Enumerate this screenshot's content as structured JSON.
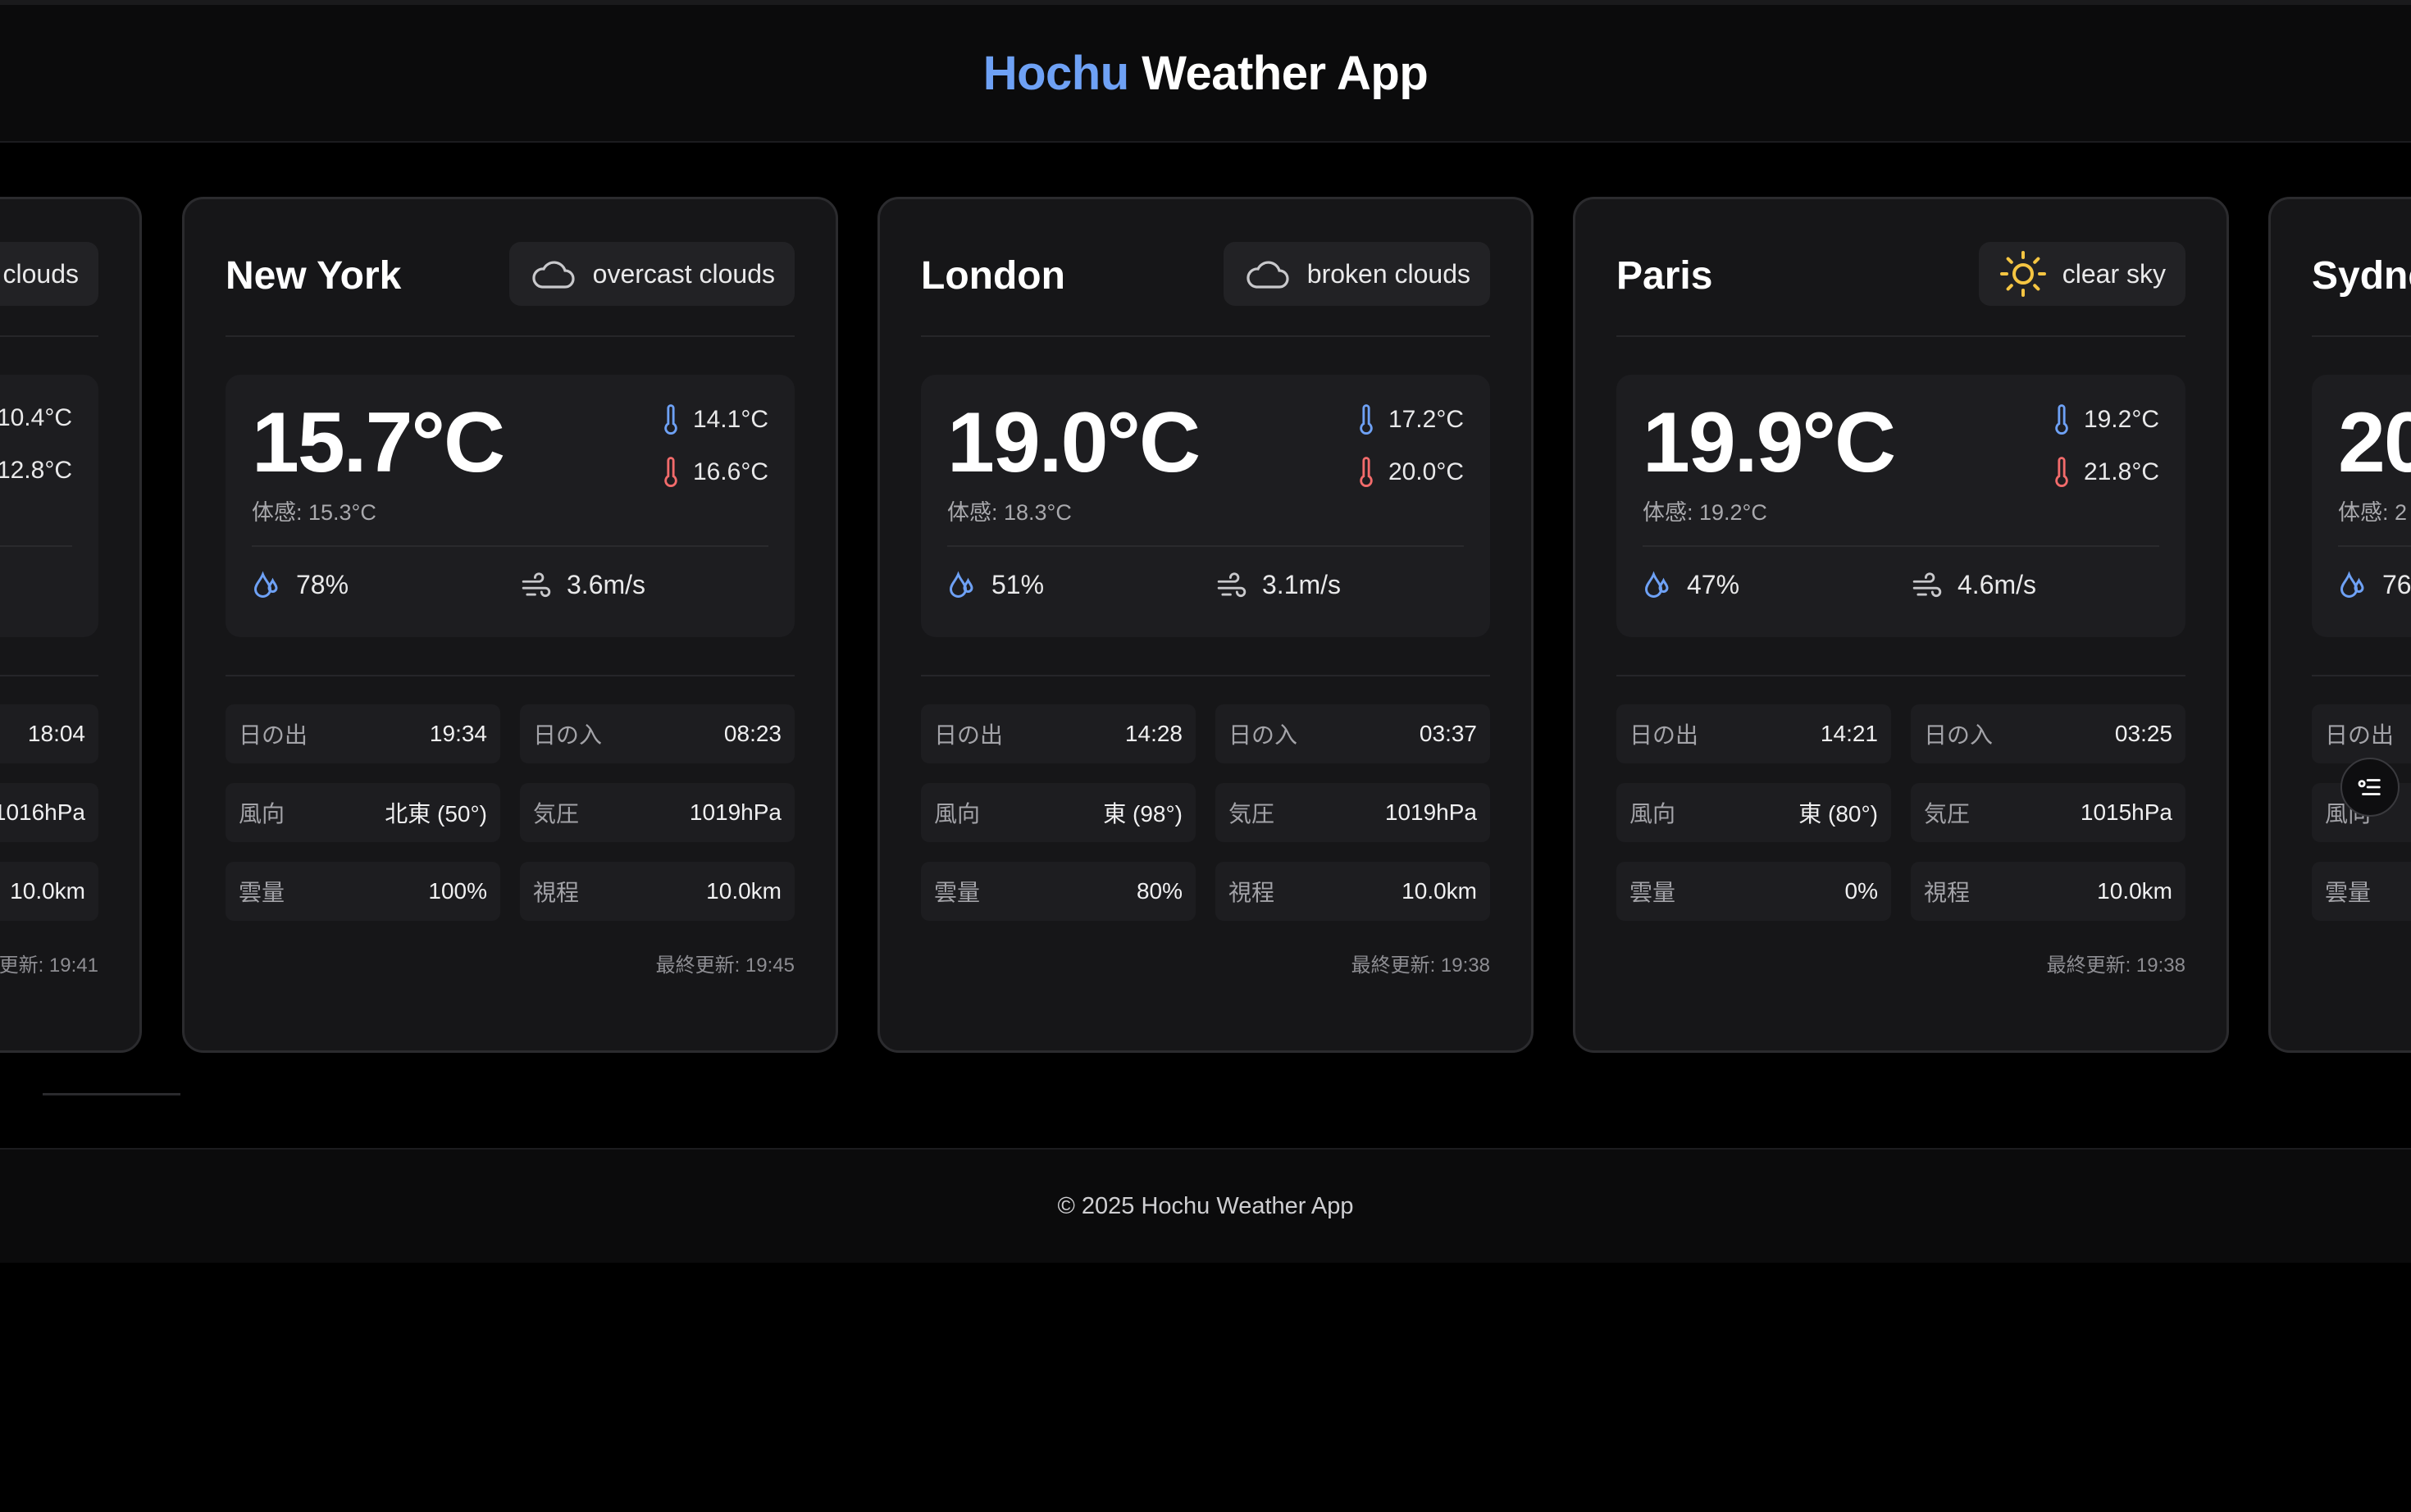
{
  "header": {
    "brand": "Hochu",
    "title_rest": " Weather App"
  },
  "labels": {
    "feels_prefix": "体感: ",
    "sunrise": "日の出",
    "sunset": "日の入",
    "wind_dir": "風向",
    "pressure": "気圧",
    "clouds": "雲量",
    "visibility": "視程",
    "updated_prefix": "最終更新: "
  },
  "cards": [
    {
      "city": "",
      "condition": "clouds",
      "condition_icon": "cloud-icon",
      "temp_min": "10.4°C",
      "temp_max": "12.8°C",
      "sunset": "18:04",
      "pressure": "1016hPa",
      "visibility": "10.0km",
      "updated": "更新: 19:41"
    },
    {
      "city": "New York",
      "condition": "overcast clouds",
      "condition_icon": "cloud-icon",
      "temp": "15.7°C",
      "feels": "体感: 15.3°C",
      "temp_min": "14.1°C",
      "temp_max": "16.6°C",
      "humidity": "78%",
      "wind": "3.6m/s",
      "sunrise": "19:34",
      "sunset": "08:23",
      "wind_dir": "北東 (50°)",
      "pressure": "1019hPa",
      "clouds": "100%",
      "visibility": "10.0km",
      "updated": "最終更新: 19:45"
    },
    {
      "city": "London",
      "condition": "broken clouds",
      "condition_icon": "cloud-icon",
      "temp": "19.0°C",
      "feels": "体感: 18.3°C",
      "temp_min": "17.2°C",
      "temp_max": "20.0°C",
      "humidity": "51%",
      "wind": "3.1m/s",
      "sunrise": "14:28",
      "sunset": "03:37",
      "wind_dir": "東 (98°)",
      "pressure": "1019hPa",
      "clouds": "80%",
      "visibility": "10.0km",
      "updated": "最終更新: 19:38"
    },
    {
      "city": "Paris",
      "condition": "clear sky",
      "condition_icon": "sun-icon",
      "temp": "19.9°C",
      "feels": "体感: 19.2°C",
      "temp_min": "19.2°C",
      "temp_max": "21.8°C",
      "humidity": "47%",
      "wind": "4.6m/s",
      "sunrise": "14:21",
      "sunset": "03:25",
      "wind_dir": "東 (80°)",
      "pressure": "1015hPa",
      "clouds": "0%",
      "visibility": "10.0km",
      "updated": "最終更新: 19:38"
    },
    {
      "city": "Sydne",
      "temp": "20",
      "feels": "体感: 2",
      "humidity": "76",
      "sunrise_label": "日の出",
      "wind_dir_label": "風向",
      "clouds_label": "雲量"
    }
  ],
  "footer": {
    "text": "© 2025 Hochu Weather App"
  },
  "fab_icon": "filter-icon"
}
